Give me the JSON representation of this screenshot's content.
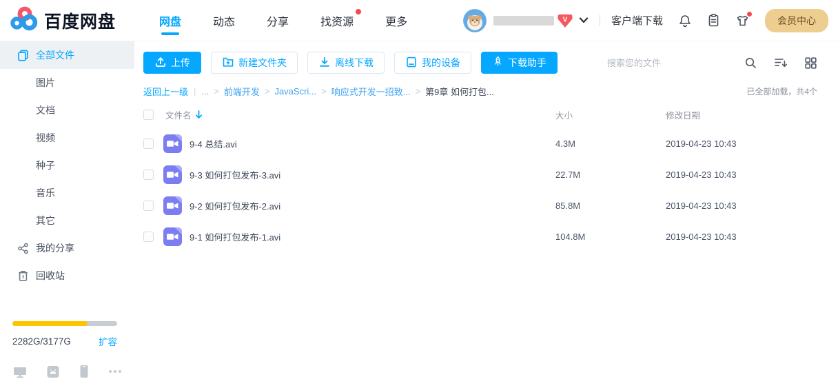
{
  "colors": {
    "accent": "#06a7ff",
    "red": "#f5484d",
    "purple": "#7b7df1",
    "purple-light": "#a9abf7",
    "gold-bg": "#eecd90",
    "gold-text": "#6d4e1d",
    "progress-yellow": "#fdc400",
    "active-bg": "#eef1f4"
  },
  "header": {
    "logo_text": "百度网盘",
    "tabs": [
      {
        "label": "网盘",
        "active": true
      },
      {
        "label": "动态",
        "active": false
      },
      {
        "label": "分享",
        "active": false
      },
      {
        "label": "找资源",
        "active": false,
        "badge": true
      },
      {
        "label": "更多",
        "active": false
      }
    ],
    "vip_badge_letter": "V",
    "client_download_label": "客户端下载",
    "vip_center_label": "会员中心"
  },
  "sidebar": {
    "items": [
      {
        "label": "全部文件",
        "active": true
      },
      {
        "label": "图片"
      },
      {
        "label": "文档"
      },
      {
        "label": "视频"
      },
      {
        "label": "种子"
      },
      {
        "label": "音乐"
      },
      {
        "label": "其它"
      },
      {
        "label": "我的分享"
      },
      {
        "label": "回收站"
      }
    ],
    "storage": {
      "quota_label": "2282G/3177G",
      "expand_label": "扩容",
      "percent": 72
    }
  },
  "toolbar": {
    "upload_label": "上传",
    "new_folder_label": "新建文件夹",
    "offline_download_label": "离线下载",
    "my_devices_label": "我的设备",
    "download_helper_label": "下载助手",
    "search_placeholder": "搜索您的文件"
  },
  "breadcrumb": {
    "back_label": "返回上一级",
    "pipe": "|",
    "ellipsis": "...",
    "sep": ">",
    "links": [
      "前端开发",
      "JavaScri...",
      "响应式开发一招致..."
    ],
    "current": "第9章 如何打包...",
    "load_status": "已全部加载，共4个"
  },
  "table": {
    "headers": {
      "name": "文件名",
      "size": "大小",
      "date": "修改日期"
    },
    "rows": [
      {
        "name": "9-4 总结.avi",
        "size": "4.3M",
        "date": "2019-04-23 10:43"
      },
      {
        "name": "9-3 如何打包发布-3.avi",
        "size": "22.7M",
        "date": "2019-04-23 10:43"
      },
      {
        "name": "9-2 如何打包发布-2.avi",
        "size": "85.8M",
        "date": "2019-04-23 10:43"
      },
      {
        "name": "9-1 如何打包发布-1.avi",
        "size": "104.8M",
        "date": "2019-04-23 10:43"
      }
    ]
  }
}
